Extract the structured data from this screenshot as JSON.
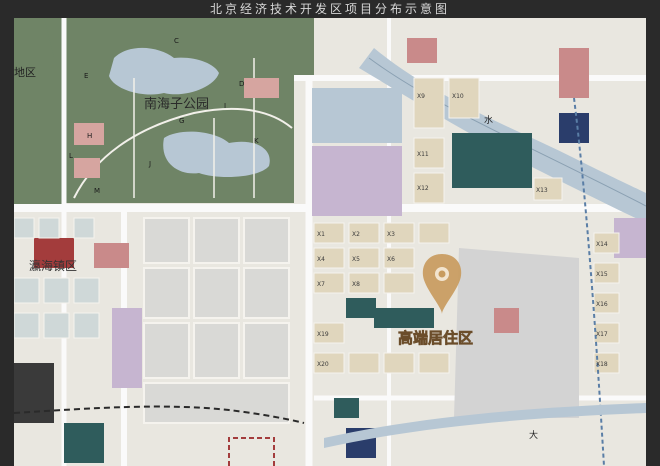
{
  "page_title": "北京经济技术开发区项目分布示意图",
  "map": {
    "park_label": "南海子公园",
    "highlight_label": "高端居住区",
    "town_label": "瀛海镇区",
    "edge_label": "地区",
    "road_char_water": "水",
    "road_char_big": "大",
    "colors": {
      "background": "#2a2a2a",
      "base": "#e9e7e0",
      "park_green": "#6f8466",
      "water_blue": "#b7c7d4",
      "teal": "#2f5c5c",
      "pink": "#c98a8a",
      "purple": "#c6b5d0",
      "navy": "#2a3d6b",
      "pin_gold": "#c89b5e"
    },
    "park_letters": [
      "C",
      "D",
      "E",
      "G",
      "H",
      "I",
      "J",
      "K",
      "L",
      "M"
    ],
    "block_codes": [
      "X1",
      "X2",
      "X3",
      "X4",
      "X5",
      "X6",
      "X7",
      "X8",
      "X9",
      "X10",
      "X11",
      "X12",
      "X13",
      "X14",
      "X15",
      "X16",
      "X17",
      "X18",
      "X19",
      "X20"
    ]
  }
}
